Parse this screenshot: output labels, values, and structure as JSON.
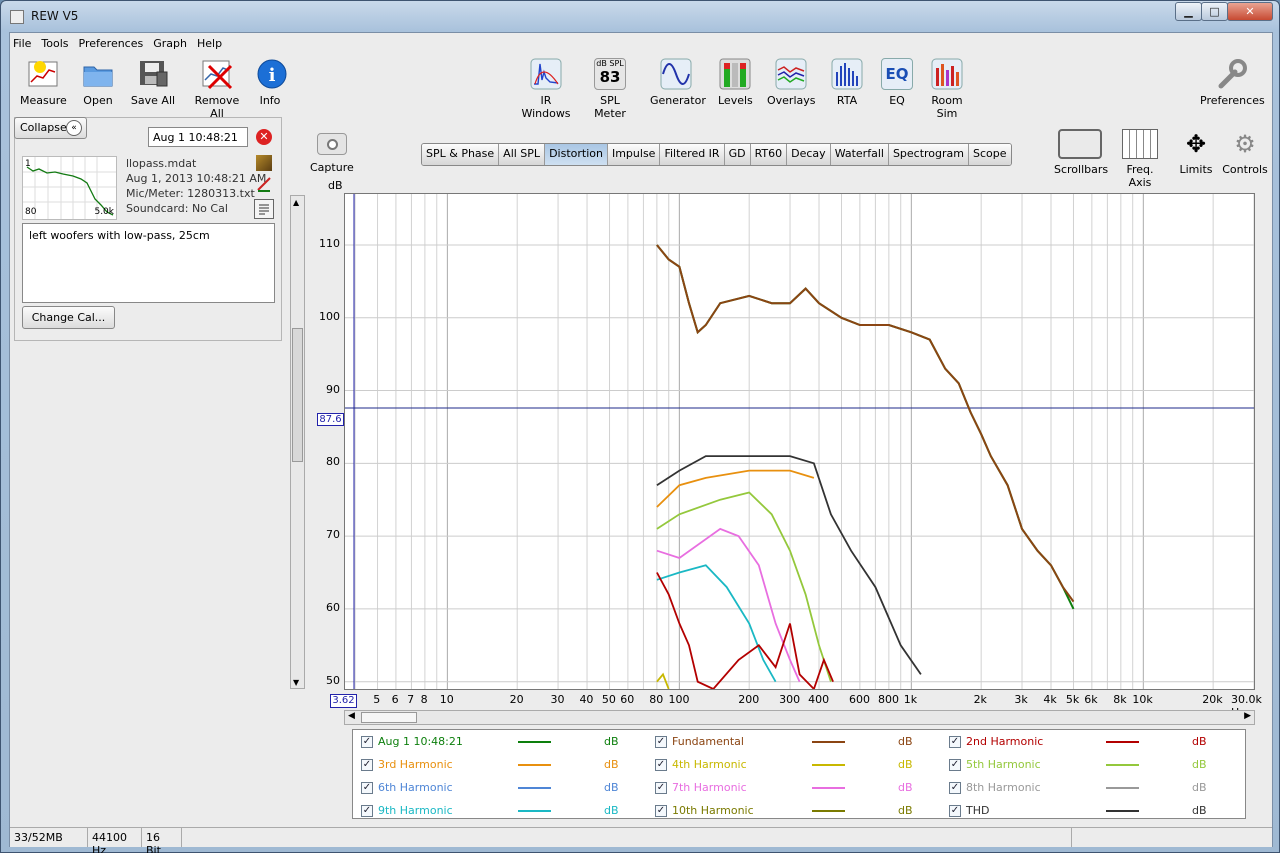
{
  "window": {
    "title": "REW V5",
    "minimize": "▁",
    "maximize": "□",
    "close": "✕"
  },
  "menu": [
    "File",
    "Tools",
    "Preferences",
    "Graph",
    "Help"
  ],
  "toolbar_left": [
    {
      "label": "Measure",
      "icon": "measure-icon"
    },
    {
      "label": "Open",
      "icon": "folder-icon"
    },
    {
      "label": "Save All",
      "icon": "save-icon"
    },
    {
      "label": "Remove All",
      "icon": "remove-all-icon"
    },
    {
      "label": "Info",
      "icon": "info-icon"
    }
  ],
  "toolbar_center": [
    {
      "label": "IR Windows",
      "icon": "ir-windows-icon"
    },
    {
      "label": "SPL Meter",
      "icon": "spl-meter-icon",
      "top": "dB SPL",
      "value": "83"
    },
    {
      "label": "Generator",
      "icon": "generator-icon"
    },
    {
      "label": "Levels",
      "icon": "levels-icon"
    },
    {
      "label": "Overlays",
      "icon": "overlays-icon"
    },
    {
      "label": "RTA",
      "icon": "rta-icon"
    },
    {
      "label": "EQ",
      "icon": "eq-icon",
      "text": "EQ"
    },
    {
      "label": "Room Sim",
      "icon": "room-sim-icon"
    }
  ],
  "toolbar_right": {
    "label": "Preferences",
    "icon": "wrench-icon"
  },
  "panel": {
    "collapse": "Collapse",
    "measurement_name": "Aug 1 10:48:21",
    "file": "llopass.mdat",
    "date": "Aug 1, 2013 10:48:21 AM",
    "mic": "Mic/Meter: 1280313.txt",
    "soundcard": "Soundcard: No Cal",
    "notes": "left woofers with low-pass, 25cm",
    "change_cal": "Change Cal...",
    "thumb_left": "80",
    "thumb_right": "5.0k",
    "thumb_top": "1"
  },
  "capture": "Capture",
  "tabs": [
    "SPL & Phase",
    "All SPL",
    "Distortion",
    "Impulse",
    "Filtered IR",
    "GD",
    "RT60",
    "Decay",
    "Waterfall",
    "Spectrogram",
    "Scope"
  ],
  "active_tab": "Distortion",
  "graph_tools": [
    {
      "label": "Scrollbars",
      "icon": "scrollbars-icon"
    },
    {
      "label": "Freq. Axis",
      "icon": "freq-axis-icon"
    },
    {
      "label": "Limits",
      "icon": "limits-icon"
    },
    {
      "label": "Controls",
      "icon": "controls-gear-icon"
    }
  ],
  "plot": {
    "y_unit": "dB",
    "cursor_y": "87.6",
    "cursor_x": "3.62",
    "y_ticks": [
      "110",
      "100",
      "90",
      "80",
      "70",
      "60",
      "50"
    ],
    "x_ticks": [
      "5",
      "6",
      "7",
      "8",
      "10",
      "20",
      "30",
      "40",
      "50",
      "60",
      "80",
      "100",
      "200",
      "300",
      "400",
      "600",
      "800",
      "1k",
      "2k",
      "3k",
      "4k",
      "5k",
      "6k",
      "8k",
      "10k",
      "20k",
      "30.0k Hz"
    ]
  },
  "legend": [
    {
      "label": "Aug 1 10:48:21",
      "color": "#0d7f0d",
      "unit": "dB"
    },
    {
      "label": "Fundamental",
      "color": "#8b4513",
      "unit": "dB"
    },
    {
      "label": "2nd Harmonic",
      "color": "#b30000",
      "unit": "dB"
    },
    {
      "label": "3rd Harmonic",
      "color": "#e8900f",
      "unit": "dB"
    },
    {
      "label": "4th Harmonic",
      "color": "#c8b800",
      "unit": "dB"
    },
    {
      "label": "5th Harmonic",
      "color": "#94c83c",
      "unit": "dB"
    },
    {
      "label": "6th Harmonic",
      "color": "#4f86d6",
      "unit": "dB"
    },
    {
      "label": "7th Harmonic",
      "color": "#e86ee0",
      "unit": "dB"
    },
    {
      "label": "8th Harmonic",
      "color": "#999999",
      "unit": "dB"
    },
    {
      "label": "9th Harmonic",
      "color": "#1ab8c4",
      "unit": "dB"
    },
    {
      "label": "10th Harmonic",
      "color": "#7a7a00",
      "unit": "dB"
    },
    {
      "label": "THD",
      "color": "#333333",
      "unit": "dB"
    }
  ],
  "status": [
    "33/52MB",
    "44100 Hz",
    "16 Bit"
  ],
  "chart_data": {
    "type": "line",
    "xlabel": "",
    "ylabel": "dB",
    "x_scale": "log",
    "xlim": [
      3.62,
      30000
    ],
    "ylim": [
      49,
      117
    ],
    "cursor_level": 87.6,
    "series": [
      {
        "name": "Aug 1 10:48:21",
        "color": "#0d7f0d",
        "points": [
          [
            80,
            110
          ],
          [
            90,
            108
          ],
          [
            100,
            107
          ],
          [
            110,
            102
          ],
          [
            120,
            98
          ],
          [
            130,
            99
          ],
          [
            150,
            102
          ],
          [
            200,
            103
          ],
          [
            250,
            102
          ],
          [
            300,
            102
          ],
          [
            350,
            104
          ],
          [
            400,
            102
          ],
          [
            500,
            100
          ],
          [
            600,
            99
          ],
          [
            700,
            99
          ],
          [
            800,
            99
          ],
          [
            1000,
            98
          ],
          [
            1200,
            97
          ],
          [
            1400,
            93
          ],
          [
            1600,
            91
          ],
          [
            1800,
            87
          ],
          [
            2000,
            84
          ],
          [
            2200,
            81
          ],
          [
            2600,
            77
          ],
          [
            3000,
            71
          ],
          [
            3500,
            68
          ],
          [
            4000,
            66
          ],
          [
            4500,
            63
          ],
          [
            5000,
            60
          ]
        ]
      },
      {
        "name": "Fundamental",
        "color": "#8b4513",
        "points": [
          [
            80,
            110
          ],
          [
            90,
            108
          ],
          [
            100,
            107
          ],
          [
            110,
            102
          ],
          [
            120,
            98
          ],
          [
            130,
            99
          ],
          [
            150,
            102
          ],
          [
            200,
            103
          ],
          [
            250,
            102
          ],
          [
            300,
            102
          ],
          [
            350,
            104
          ],
          [
            400,
            102
          ],
          [
            500,
            100
          ],
          [
            600,
            99
          ],
          [
            700,
            99
          ],
          [
            800,
            99
          ],
          [
            1000,
            98
          ],
          [
            1200,
            97
          ],
          [
            1400,
            93
          ],
          [
            1600,
            91
          ],
          [
            1800,
            87
          ],
          [
            2000,
            84
          ],
          [
            2200,
            81
          ],
          [
            2600,
            77
          ],
          [
            3000,
            71
          ],
          [
            3500,
            68
          ],
          [
            4000,
            66
          ],
          [
            4500,
            63
          ],
          [
            5000,
            61
          ]
        ]
      },
      {
        "name": "THD",
        "color": "#333333",
        "points": [
          [
            80,
            77
          ],
          [
            100,
            79
          ],
          [
            130,
            81
          ],
          [
            200,
            81
          ],
          [
            300,
            81
          ],
          [
            380,
            80
          ],
          [
            450,
            73
          ],
          [
            550,
            68
          ],
          [
            700,
            63
          ],
          [
            900,
            55
          ],
          [
            1100,
            51
          ]
        ]
      },
      {
        "name": "3rd Harmonic",
        "color": "#e8900f",
        "points": [
          [
            80,
            74
          ],
          [
            100,
            77
          ],
          [
            130,
            78
          ],
          [
            200,
            79
          ],
          [
            300,
            79
          ],
          [
            380,
            78
          ]
        ]
      },
      {
        "name": "5th Harmonic",
        "color": "#94c83c",
        "points": [
          [
            80,
            71
          ],
          [
            100,
            73
          ],
          [
            150,
            75
          ],
          [
            200,
            76
          ],
          [
            250,
            73
          ],
          [
            300,
            68
          ],
          [
            350,
            62
          ],
          [
            400,
            55
          ],
          [
            450,
            50
          ]
        ]
      },
      {
        "name": "7th Harmonic",
        "color": "#e86ee0",
        "points": [
          [
            80,
            68
          ],
          [
            100,
            67
          ],
          [
            150,
            71
          ],
          [
            180,
            70
          ],
          [
            220,
            66
          ],
          [
            260,
            58
          ],
          [
            300,
            53
          ],
          [
            330,
            50
          ]
        ]
      },
      {
        "name": "9th Harmonic",
        "color": "#1ab8c4",
        "points": [
          [
            80,
            64
          ],
          [
            100,
            65
          ],
          [
            130,
            66
          ],
          [
            160,
            63
          ],
          [
            200,
            58
          ],
          [
            230,
            53
          ],
          [
            260,
            50
          ]
        ]
      },
      {
        "name": "2nd Harmonic",
        "color": "#b30000",
        "points": [
          [
            80,
            65
          ],
          [
            90,
            62
          ],
          [
            100,
            58
          ],
          [
            110,
            55
          ],
          [
            120,
            50
          ],
          [
            140,
            49
          ],
          [
            180,
            53
          ],
          [
            220,
            55
          ],
          [
            260,
            52
          ],
          [
            300,
            58
          ],
          [
            330,
            51
          ],
          [
            380,
            49
          ],
          [
            420,
            53
          ],
          [
            460,
            50
          ]
        ]
      },
      {
        "name": "4th Harmonic",
        "color": "#c8b800",
        "points": [
          [
            80,
            50
          ],
          [
            85,
            51
          ],
          [
            90,
            49
          ]
        ]
      }
    ]
  }
}
